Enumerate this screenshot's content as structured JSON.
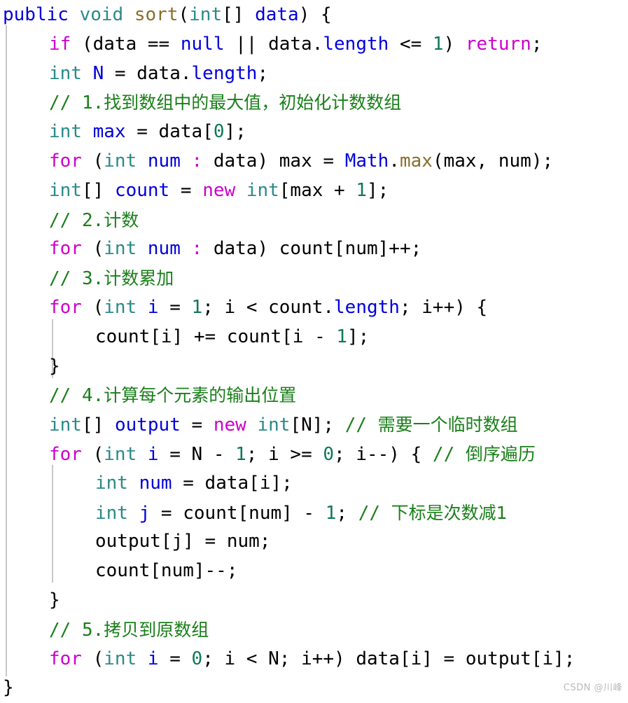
{
  "editor": {
    "language": "java",
    "background_color": "#ffffff",
    "theme_colors": {
      "keyword": "#CC00CC",
      "modifier": "#0000DD",
      "type": "#2B8A8A",
      "method": "#8A6D2B",
      "identifier": "#0000DD",
      "number": "#0E7A52",
      "plain": "#000000",
      "comment": "#1A7F1A",
      "indent_guide": "#c8c8c8",
      "watermark": "#b9b9b9"
    }
  },
  "watermark": {
    "text": "CSDN @川峰"
  },
  "code": {
    "lines": [
      {
        "indent": 0,
        "tokens": [
          {
            "t": "public",
            "c": "mod"
          },
          {
            "t": " ",
            "c": "plain"
          },
          {
            "t": "void",
            "c": "type"
          },
          {
            "t": " ",
            "c": "plain"
          },
          {
            "t": "sort",
            "c": "method"
          },
          {
            "t": "(",
            "c": "plain"
          },
          {
            "t": "int",
            "c": "type"
          },
          {
            "t": "[] ",
            "c": "plain"
          },
          {
            "t": "data",
            "c": "ident"
          },
          {
            "t": ") {",
            "c": "plain"
          }
        ]
      },
      {
        "indent": 1,
        "tokens": [
          {
            "t": "if",
            "c": "kw"
          },
          {
            "t": " (data == ",
            "c": "plain"
          },
          {
            "t": "null",
            "c": "mod"
          },
          {
            "t": " || data.",
            "c": "plain"
          },
          {
            "t": "length",
            "c": "ident"
          },
          {
            "t": " <= ",
            "c": "plain"
          },
          {
            "t": "1",
            "c": "num"
          },
          {
            "t": ") ",
            "c": "plain"
          },
          {
            "t": "return",
            "c": "kw"
          },
          {
            "t": ";",
            "c": "plain"
          }
        ]
      },
      {
        "indent": 1,
        "tokens": [
          {
            "t": "int",
            "c": "type"
          },
          {
            "t": " ",
            "c": "plain"
          },
          {
            "t": "N",
            "c": "ident"
          },
          {
            "t": " = data.",
            "c": "plain"
          },
          {
            "t": "length",
            "c": "ident"
          },
          {
            "t": ";",
            "c": "plain"
          }
        ]
      },
      {
        "indent": 1,
        "tokens": [
          {
            "t": "// ",
            "c": "comment"
          },
          {
            "t": "1.",
            "c": "comment"
          },
          {
            "t": "找到数组中的最大值，初始化计数数组",
            "c": "comment-zh"
          }
        ]
      },
      {
        "indent": 1,
        "tokens": [
          {
            "t": "int",
            "c": "type"
          },
          {
            "t": " ",
            "c": "plain"
          },
          {
            "t": "max",
            "c": "ident"
          },
          {
            "t": " = data[",
            "c": "plain"
          },
          {
            "t": "0",
            "c": "num"
          },
          {
            "t": "];",
            "c": "plain"
          }
        ]
      },
      {
        "indent": 1,
        "tokens": [
          {
            "t": "for",
            "c": "kw"
          },
          {
            "t": " (",
            "c": "plain"
          },
          {
            "t": "int",
            "c": "type"
          },
          {
            "t": " ",
            "c": "plain"
          },
          {
            "t": "num",
            "c": "ident"
          },
          {
            "t": " ",
            "c": "plain"
          },
          {
            "t": ":",
            "c": "kw"
          },
          {
            "t": " data) max = ",
            "c": "plain"
          },
          {
            "t": "Math",
            "c": "ident"
          },
          {
            "t": ".",
            "c": "plain"
          },
          {
            "t": "max",
            "c": "method"
          },
          {
            "t": "(max, num);",
            "c": "plain"
          }
        ]
      },
      {
        "indent": 1,
        "tokens": [
          {
            "t": "int",
            "c": "type"
          },
          {
            "t": "[] ",
            "c": "plain"
          },
          {
            "t": "count",
            "c": "ident"
          },
          {
            "t": " = ",
            "c": "plain"
          },
          {
            "t": "new",
            "c": "kw"
          },
          {
            "t": " ",
            "c": "plain"
          },
          {
            "t": "int",
            "c": "type"
          },
          {
            "t": "[max + ",
            "c": "plain"
          },
          {
            "t": "1",
            "c": "num"
          },
          {
            "t": "];",
            "c": "plain"
          }
        ]
      },
      {
        "indent": 1,
        "tokens": [
          {
            "t": "// ",
            "c": "comment"
          },
          {
            "t": "2.",
            "c": "comment"
          },
          {
            "t": "计数",
            "c": "comment-zh"
          }
        ]
      },
      {
        "indent": 1,
        "tokens": [
          {
            "t": "for",
            "c": "kw"
          },
          {
            "t": " (",
            "c": "plain"
          },
          {
            "t": "int",
            "c": "type"
          },
          {
            "t": " ",
            "c": "plain"
          },
          {
            "t": "num",
            "c": "ident"
          },
          {
            "t": " ",
            "c": "plain"
          },
          {
            "t": ":",
            "c": "kw"
          },
          {
            "t": " data) count[num]++;",
            "c": "plain"
          }
        ]
      },
      {
        "indent": 1,
        "tokens": [
          {
            "t": "// ",
            "c": "comment"
          },
          {
            "t": "3.",
            "c": "comment"
          },
          {
            "t": "计数累加",
            "c": "comment-zh"
          }
        ]
      },
      {
        "indent": 1,
        "tokens": [
          {
            "t": "for",
            "c": "kw"
          },
          {
            "t": " (",
            "c": "plain"
          },
          {
            "t": "int",
            "c": "type"
          },
          {
            "t": " ",
            "c": "plain"
          },
          {
            "t": "i",
            "c": "ident"
          },
          {
            "t": " = ",
            "c": "plain"
          },
          {
            "t": "1",
            "c": "num"
          },
          {
            "t": "; i < count.",
            "c": "plain"
          },
          {
            "t": "length",
            "c": "ident"
          },
          {
            "t": "; i++) {",
            "c": "plain"
          }
        ]
      },
      {
        "indent": 2,
        "tokens": [
          {
            "t": "count[i] += count[i - ",
            "c": "plain"
          },
          {
            "t": "1",
            "c": "num"
          },
          {
            "t": "];",
            "c": "plain"
          }
        ]
      },
      {
        "indent": 1,
        "tokens": [
          {
            "t": "}",
            "c": "plain"
          }
        ]
      },
      {
        "indent": 1,
        "tokens": [
          {
            "t": "// ",
            "c": "comment"
          },
          {
            "t": "4.",
            "c": "comment"
          },
          {
            "t": "计算每个元素的输出位置",
            "c": "comment-zh"
          }
        ]
      },
      {
        "indent": 1,
        "tokens": [
          {
            "t": "int",
            "c": "type"
          },
          {
            "t": "[] ",
            "c": "plain"
          },
          {
            "t": "output",
            "c": "ident"
          },
          {
            "t": " = ",
            "c": "plain"
          },
          {
            "t": "new",
            "c": "kw"
          },
          {
            "t": " ",
            "c": "plain"
          },
          {
            "t": "int",
            "c": "type"
          },
          {
            "t": "[N]; ",
            "c": "plain"
          },
          {
            "t": "// ",
            "c": "comment"
          },
          {
            "t": "需要一个临时数组",
            "c": "comment-zh"
          }
        ]
      },
      {
        "indent": 1,
        "tokens": [
          {
            "t": "for",
            "c": "kw"
          },
          {
            "t": " (",
            "c": "plain"
          },
          {
            "t": "int",
            "c": "type"
          },
          {
            "t": " ",
            "c": "plain"
          },
          {
            "t": "i",
            "c": "ident"
          },
          {
            "t": " = N - ",
            "c": "plain"
          },
          {
            "t": "1",
            "c": "num"
          },
          {
            "t": "; i >= ",
            "c": "plain"
          },
          {
            "t": "0",
            "c": "num"
          },
          {
            "t": "; i--) { ",
            "c": "plain"
          },
          {
            "t": "// ",
            "c": "comment"
          },
          {
            "t": "倒序遍历",
            "c": "comment-zh"
          }
        ]
      },
      {
        "indent": 2,
        "tokens": [
          {
            "t": "int",
            "c": "type"
          },
          {
            "t": " ",
            "c": "plain"
          },
          {
            "t": "num",
            "c": "ident"
          },
          {
            "t": " = data[i];",
            "c": "plain"
          }
        ]
      },
      {
        "indent": 2,
        "tokens": [
          {
            "t": "int",
            "c": "type"
          },
          {
            "t": " ",
            "c": "plain"
          },
          {
            "t": "j",
            "c": "ident"
          },
          {
            "t": " = count[num] - ",
            "c": "plain"
          },
          {
            "t": "1",
            "c": "num"
          },
          {
            "t": "; ",
            "c": "plain"
          },
          {
            "t": "// ",
            "c": "comment"
          },
          {
            "t": "下标是次数减1",
            "c": "comment-zh"
          }
        ]
      },
      {
        "indent": 2,
        "tokens": [
          {
            "t": "output[j] = num;",
            "c": "plain"
          }
        ]
      },
      {
        "indent": 2,
        "tokens": [
          {
            "t": "count[num]--;",
            "c": "plain"
          }
        ]
      },
      {
        "indent": 1,
        "tokens": [
          {
            "t": "}",
            "c": "plain"
          }
        ]
      },
      {
        "indent": 1,
        "tokens": [
          {
            "t": "// ",
            "c": "comment"
          },
          {
            "t": "5.",
            "c": "comment"
          },
          {
            "t": "拷贝到原数组",
            "c": "comment-zh"
          }
        ]
      },
      {
        "indent": 1,
        "tokens": [
          {
            "t": "for",
            "c": "kw"
          },
          {
            "t": " (",
            "c": "plain"
          },
          {
            "t": "int",
            "c": "type"
          },
          {
            "t": " ",
            "c": "plain"
          },
          {
            "t": "i",
            "c": "ident"
          },
          {
            "t": " = ",
            "c": "plain"
          },
          {
            "t": "0",
            "c": "num"
          },
          {
            "t": "; i < N; i++) data[i] = output[i];",
            "c": "plain"
          }
        ]
      },
      {
        "indent": 0,
        "tokens": [
          {
            "t": "}",
            "c": "plain"
          }
        ]
      }
    ]
  }
}
